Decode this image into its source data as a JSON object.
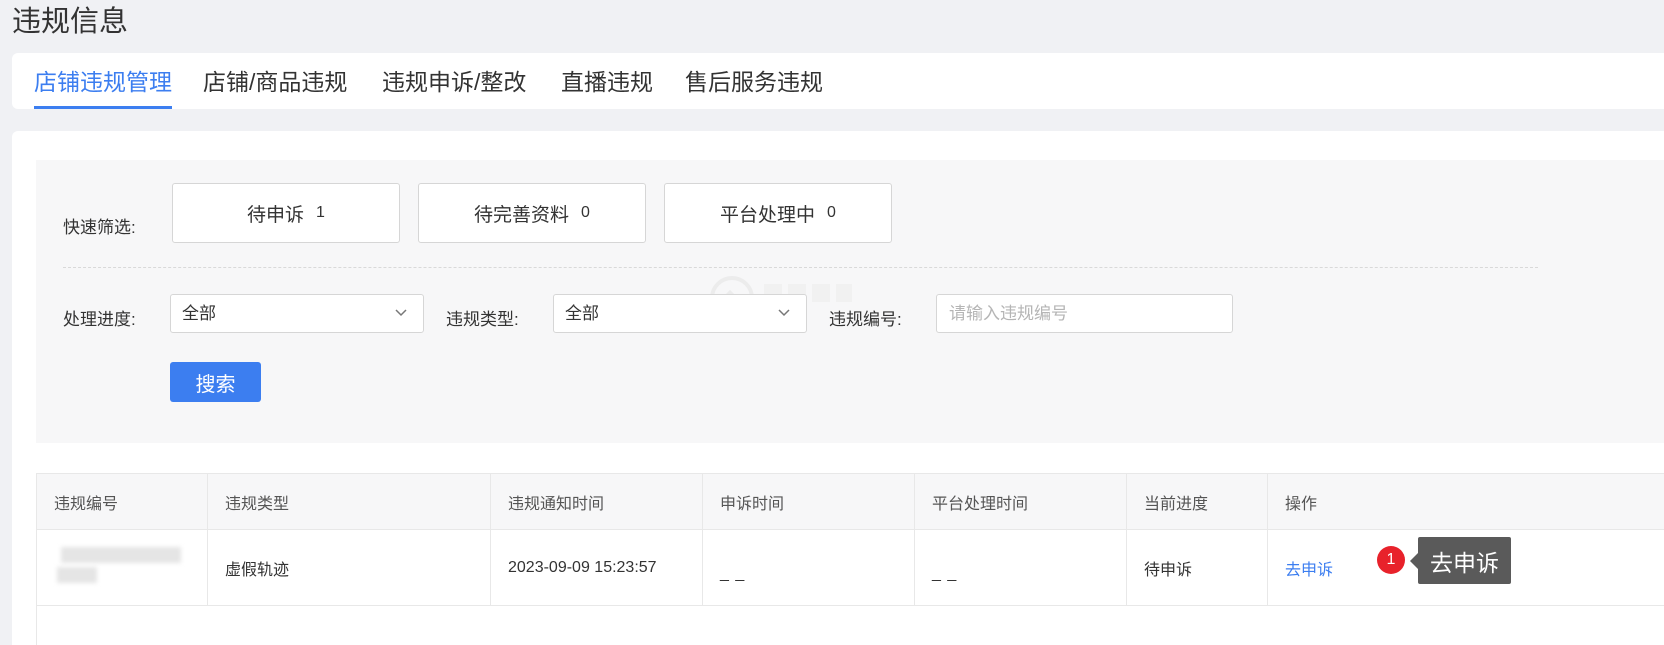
{
  "page": {
    "title": "违规信息"
  },
  "tabs": [
    {
      "label": "店铺违规管理",
      "active": true
    },
    {
      "label": "店铺/商品违规",
      "active": false
    },
    {
      "label": "违规申诉/整改",
      "active": false
    },
    {
      "label": "直播违规",
      "active": false
    },
    {
      "label": "售后服务违规",
      "active": false
    }
  ],
  "filters": {
    "quick_label": "快速筛选:",
    "quick_buttons": [
      {
        "label": "待申诉",
        "count": "1"
      },
      {
        "label": "待完善资料",
        "count": "0"
      },
      {
        "label": "平台处理中",
        "count": "0"
      }
    ],
    "progress_label": "处理进度:",
    "progress_value": "全部",
    "type_label": "违规类型:",
    "type_value": "全部",
    "id_label": "违规编号:",
    "id_placeholder": "请输入违规编号",
    "search_label": "搜索"
  },
  "table": {
    "columns": [
      "违规编号",
      "违规类型",
      "违规通知时间",
      "申诉时间",
      "平台处理时间",
      "当前进度",
      "操作"
    ],
    "rows": [
      {
        "id": "",
        "type": "虚假轨迹",
        "notice_time": "2023-09-09 15:23:57",
        "appeal_time": "_ _",
        "platform_time": "_ _",
        "progress": "待申诉",
        "action": "去申诉"
      }
    ]
  },
  "annotation": {
    "badge": "1",
    "tooltip": "去申诉"
  },
  "colors": {
    "accent": "#3c7ef0",
    "badge": "#e8222b",
    "tooltip_bg": "#5a5a5a"
  },
  "icons": {
    "select_arrow": "chevron-down-icon"
  }
}
